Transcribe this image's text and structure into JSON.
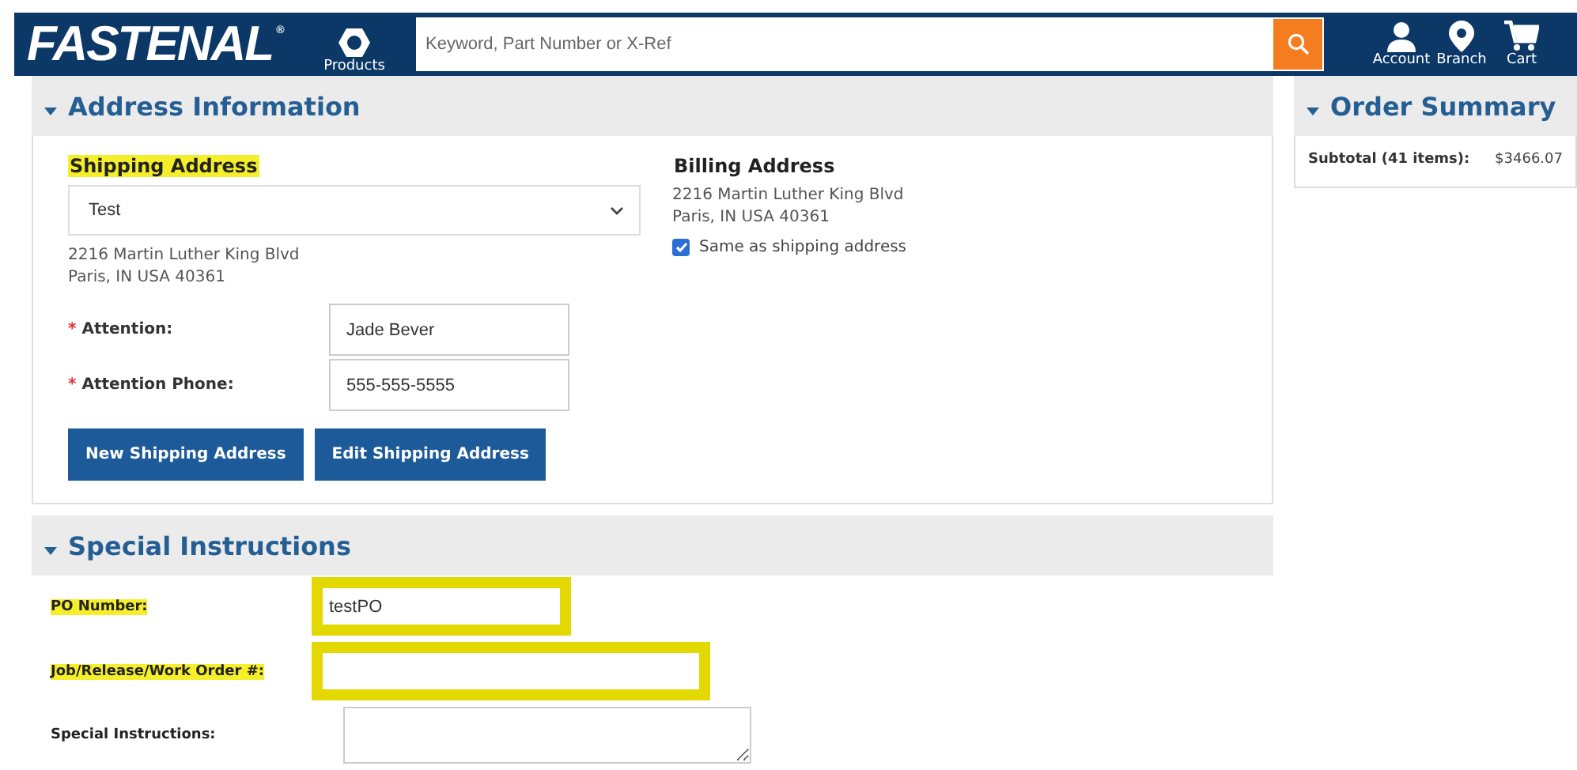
{
  "header": {
    "logo": "FASTENAL",
    "logo_mark": "®",
    "products_label": "Products",
    "search": {
      "placeholder": "Keyword, Part Number or X-Ref"
    },
    "nav": [
      {
        "label": "Account",
        "kind": "account"
      },
      {
        "label": "Branch",
        "kind": "branch"
      },
      {
        "label": "Cart",
        "kind": "cart"
      }
    ]
  },
  "address_section": {
    "title": "Address Information",
    "expanded": true,
    "shipping": {
      "heading": "Shipping Address",
      "highlighted": true,
      "selected_address": "Test",
      "address_lines": [
        "2216 Martin Luther King Blvd",
        "Paris, IN USA 40361"
      ],
      "fields": [
        {
          "label": "Attention:",
          "required_mark": "*",
          "value": "Jade Bever"
        },
        {
          "label": "Attention Phone:",
          "required_mark": "*",
          "value": "555-555-5555"
        }
      ],
      "buttons": [
        "New Shipping Address",
        "Edit Shipping Address"
      ]
    },
    "billing": {
      "heading": "Billing Address",
      "address_lines": [
        "2216 Martin Luther King Blvd",
        "Paris, IN USA 40361"
      ],
      "same_as_shipping": {
        "label": "Same as shipping address",
        "checked": true
      }
    }
  },
  "special_section": {
    "title": "Special Instructions",
    "expanded": true,
    "fields": [
      {
        "label": "PO Number:",
        "kind": "input",
        "value": "testPO",
        "highlighted": true
      },
      {
        "label": "Job/Release/Work Order #:",
        "kind": "input",
        "highlighted": true
      },
      {
        "label": "Special Instructions:",
        "kind": "textarea",
        "highlighted": false
      }
    ]
  },
  "order_summary": {
    "title": "Order Summary",
    "expanded": true,
    "subtotal_label": "Subtotal (41 items):",
    "subtotal_value": "$3466.07"
  }
}
